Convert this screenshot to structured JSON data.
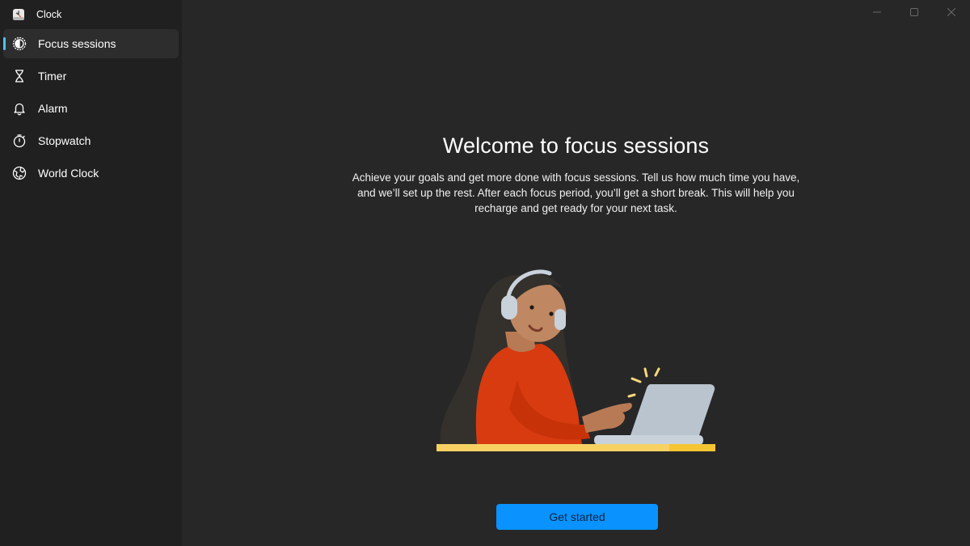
{
  "app": {
    "title": "Clock",
    "icon": "clock-app-icon"
  },
  "sidebar": {
    "items": [
      {
        "label": "Focus sessions",
        "icon": "focus-icon",
        "selected": true
      },
      {
        "label": "Timer",
        "icon": "hourglass-icon",
        "selected": false
      },
      {
        "label": "Alarm",
        "icon": "bell-icon",
        "selected": false
      },
      {
        "label": "Stopwatch",
        "icon": "stopwatch-icon",
        "selected": false
      },
      {
        "label": "World Clock",
        "icon": "globe-icon",
        "selected": false
      }
    ]
  },
  "window_controls": {
    "minimize": "minimize-icon",
    "maximize": "maximize-icon",
    "close": "close-icon"
  },
  "main": {
    "heading": "Welcome to focus sessions",
    "description": "Achieve your goals and get more done with focus sessions. Tell us how much time you have, and we’ll set up the rest. After each focus period, you’ll get a short break. This will help you recharge and get ready for your next task.",
    "illustration": "person-with-headphones-at-laptop",
    "cta_label": "Get started"
  },
  "colors": {
    "accent": "#0a93ff",
    "indicator": "#4cc2ff",
    "sidebar_bg": "#202020",
    "main_bg": "#272727",
    "selected_bg": "#2d2d2d"
  }
}
